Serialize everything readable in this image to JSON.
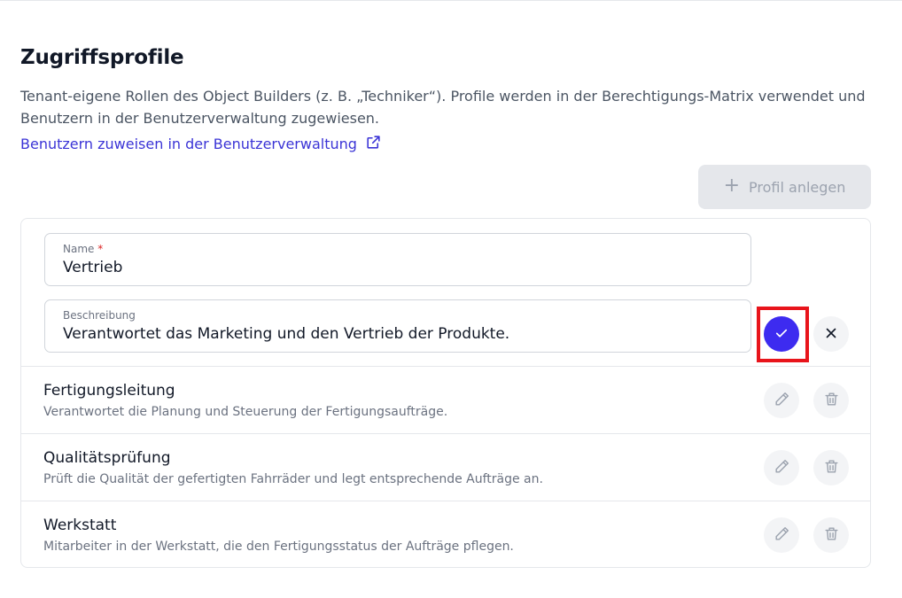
{
  "page": {
    "title": "Zugriffsprofile",
    "description": "Tenant-eigene Rollen des Object Builders (z. B. „Techniker“). Profile werden in der Berechtigungs-Matrix verwendet und Benutzern in der Benutzerverwaltung zugewiesen.",
    "link_label": "Benutzern zuweisen in der Benutzerverwaltung",
    "create_button_label": "Profil anlegen",
    "create_button_enabled": false
  },
  "edit_form": {
    "name_label": "Name",
    "name_required_mark": "*",
    "name_value": "Vertrieb",
    "description_label": "Beschreibung",
    "description_value": "Verantwortet das Marketing und den Vertrieb der Produkte."
  },
  "profiles": [
    {
      "name": "Fertigungsleitung",
      "description": "Verantwortet die Planung und Steuerung der Fertigungsaufträge."
    },
    {
      "name": "Qualitätsprüfung",
      "description": "Prüft die Qualität der gefertigten Fahrräder und legt entsprechende Aufträge an."
    },
    {
      "name": "Werkstatt",
      "description": "Mitarbeiter in der Werkstatt, die den Fertigungsstatus der Aufträge pflegen."
    }
  ],
  "icons": {
    "link": "external-link-icon",
    "create": "plus-icon",
    "confirm": "check-icon",
    "cancel": "close-icon",
    "edit": "pencil-icon",
    "delete": "trash-icon"
  },
  "colors": {
    "accent": "#3d2bf0",
    "link": "#3b34d6",
    "highlight": "#e8141b",
    "required": "#dc2626"
  }
}
